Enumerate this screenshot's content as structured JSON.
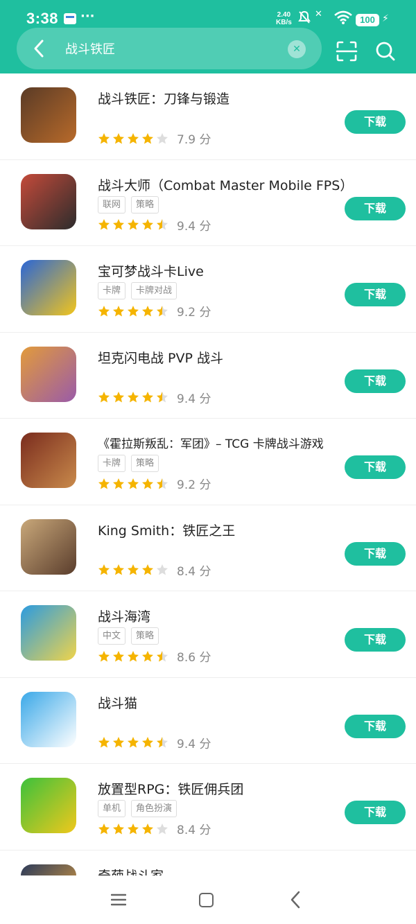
{
  "status": {
    "time": "3:38",
    "speed_value": "2.40",
    "speed_unit": "KB/s",
    "battery": "100"
  },
  "search": {
    "query": "战斗铁匠"
  },
  "apps": [
    {
      "name": "战斗铁匠：刀锋与锻造",
      "tags": [],
      "stars": 4,
      "score": "7.9 分",
      "button": "下载",
      "icon": "blacksmith-game-icon",
      "colors": [
        "#5a3b26",
        "#b86a2a"
      ]
    },
    {
      "name": "战斗大师（Combat Master Mobile FPS）",
      "tags": [
        "联网",
        "策略"
      ],
      "stars": 4.5,
      "score": "9.4 分",
      "button": "下载",
      "icon": "combat-master-icon",
      "colors": [
        "#c44a3a",
        "#2c2c2c"
      ]
    },
    {
      "name": "宝可梦战斗卡Live",
      "tags": [
        "卡牌",
        "卡牌对战"
      ],
      "stars": 4.5,
      "score": "9.2 分",
      "button": "下载",
      "icon": "pokemon-cards-icon",
      "colors": [
        "#2a66d6",
        "#f2c51c"
      ]
    },
    {
      "name": "坦克闪电战 PVP 战斗",
      "tags": [],
      "stars": 4.5,
      "score": "9.4 分",
      "button": "下载",
      "icon": "tank-blitz-icon",
      "colors": [
        "#e29b3b",
        "#9a5ba8"
      ]
    },
    {
      "name": "《霍拉斯叛乱：军团》– TCG 卡牌战斗游戏",
      "tags": [
        "卡牌",
        "策略"
      ],
      "stars": 4.5,
      "score": "9.2 分",
      "button": "下载",
      "icon": "horus-heresy-icon",
      "colors": [
        "#7a2c1e",
        "#c98a4b"
      ]
    },
    {
      "name": "King Smith：铁匠之王",
      "tags": [],
      "stars": 4,
      "score": "8.4 分",
      "button": "下载",
      "icon": "king-smith-icon",
      "colors": [
        "#c9a87a",
        "#5a3d2c"
      ]
    },
    {
      "name": "战斗海湾",
      "tags": [
        "中文",
        "策略"
      ],
      "stars": 4.5,
      "score": "8.6 分",
      "button": "下载",
      "icon": "battle-bay-icon",
      "colors": [
        "#2b9be0",
        "#f0d44a"
      ]
    },
    {
      "name": "战斗猫",
      "tags": [],
      "stars": 4.5,
      "score": "9.4 分",
      "button": "下载",
      "icon": "battle-cats-icon",
      "colors": [
        "#3aa8e8",
        "#ffffff"
      ]
    },
    {
      "name": "放置型RPG：铁匠佣兵团",
      "tags": [
        "单机",
        "角色扮演"
      ],
      "stars": 4,
      "score": "8.4 分",
      "button": "下载",
      "icon": "idle-rpg-icon",
      "colors": [
        "#3cc13c",
        "#f0c81c"
      ]
    },
    {
      "name": "奇葩战斗家",
      "tags": [],
      "stars": 0,
      "score": "",
      "button": "",
      "icon": "odd-fighter-icon",
      "colors": [
        "#2c3b5a",
        "#f0a83c"
      ]
    }
  ],
  "colors": {
    "accent": "#1fbf9f",
    "star": "#f5b400",
    "star_empty": "#dddddd"
  }
}
